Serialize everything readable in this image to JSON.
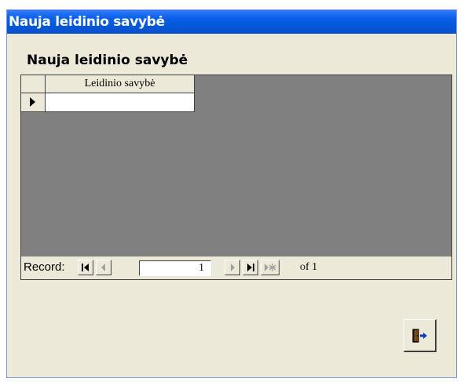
{
  "window": {
    "title": "Nauja leidinio savybė"
  },
  "form": {
    "heading": "Nauja leidinio savybė"
  },
  "datasheet": {
    "columns": [
      "Leidinio savybė"
    ],
    "rows": [
      ""
    ]
  },
  "navigation": {
    "record_label": "Record:",
    "current_record": "1",
    "of_label": "of 1",
    "buttons": [
      "first-record-icon",
      "previous-record-icon",
      "next-record-icon",
      "last-record-icon",
      "new-record-icon"
    ]
  },
  "exit_button": {
    "icon": "exit-door-icon"
  },
  "colors": {
    "titlebar": "#0a5fe8",
    "form_background": "#ece9d8",
    "datasheet_background": "#808080"
  }
}
